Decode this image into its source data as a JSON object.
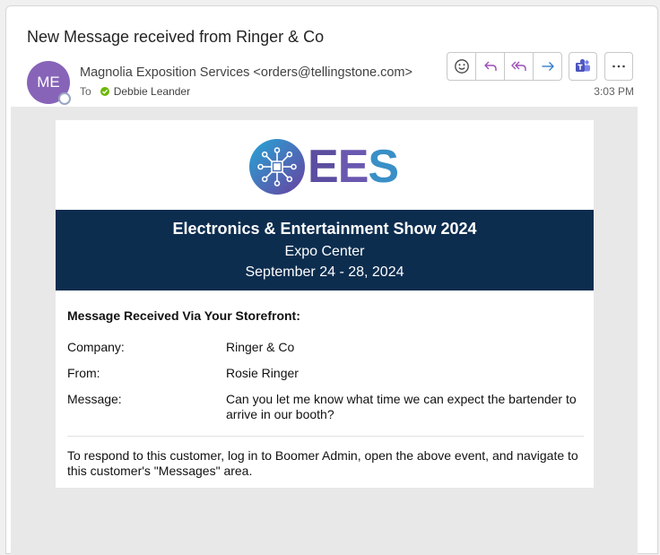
{
  "header": {
    "subject": "New Message received from Ringer & Co",
    "avatar_initials": "ME",
    "sender_display": "Magnolia Exposition Services <orders@tellingstone.com>",
    "to_label": "To",
    "recipient": "Debbie Leander",
    "time": "3:03 PM"
  },
  "toolbar": {
    "icons": [
      "emoji-icon",
      "reply-icon",
      "reply-all-icon",
      "forward-icon",
      "teams-icon",
      "more-options-icon"
    ]
  },
  "email": {
    "logo_text": {
      "part1": "E",
      "part2": "E",
      "part3": "S"
    },
    "banner": {
      "title": "Electronics & Entertainment Show 2024",
      "venue": "Expo Center",
      "dates": "September 24 - 28, 2024"
    },
    "heading": "Message Received Via Your Storefront:",
    "rows": [
      {
        "label": "Company:",
        "value": "Ringer & Co"
      },
      {
        "label": "From:",
        "value": "Rosie Ringer"
      },
      {
        "label": "Message:",
        "value": "Can you let me know what time we can expect the bartender to arrive in our booth?"
      }
    ],
    "footer": "To respond to this customer, log in to Boomer Admin, open the above event, and navigate to this customer's \"Messages\" area."
  },
  "colors": {
    "avatar": "#8764b8",
    "banner": "#0d2d4f",
    "presence_ok": "#6bb700",
    "reply_purple": "#9b4fb4",
    "forward_blue": "#2f7fd0"
  }
}
